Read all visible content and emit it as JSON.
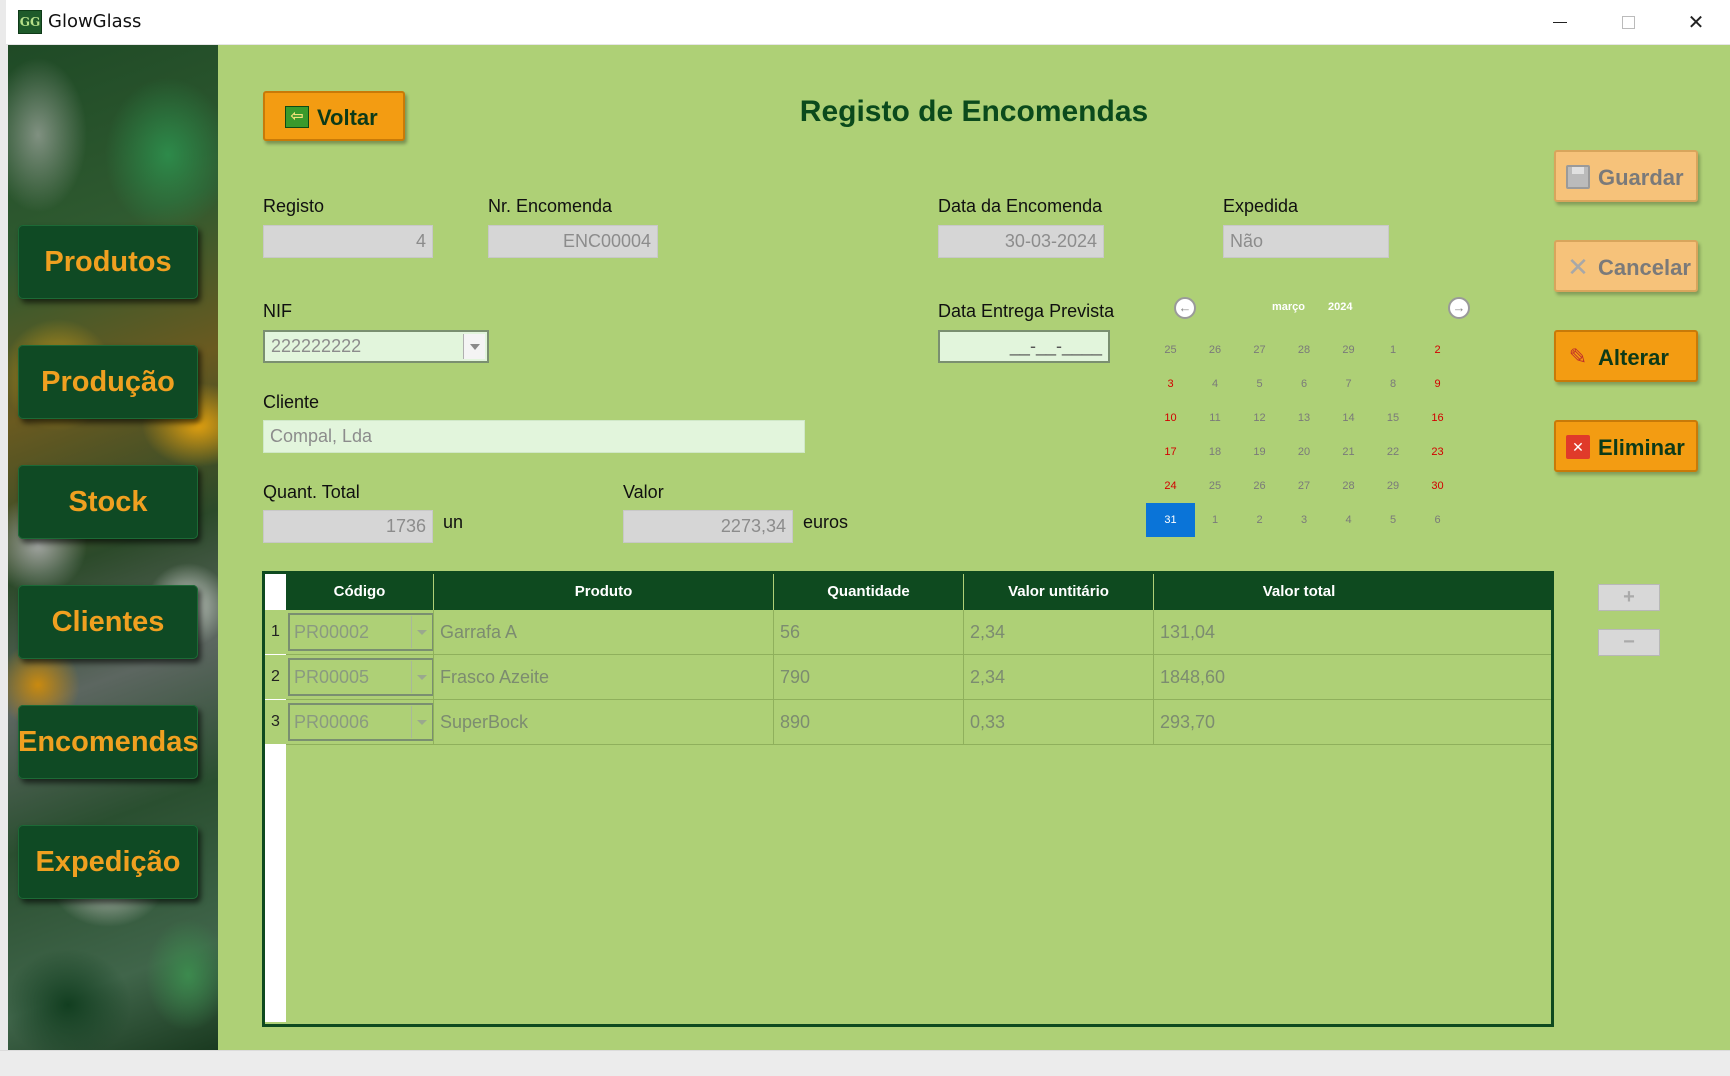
{
  "window": {
    "title": "GlowGlass",
    "icon_text": "GG",
    "minimize_icon": "minimize-icon",
    "maximize_icon": "maximize-icon",
    "close_icon": "close-icon",
    "close_glyph": "✕"
  },
  "sidebar": {
    "items": [
      {
        "label": "Produtos"
      },
      {
        "label": "Produção"
      },
      {
        "label": "Stock"
      },
      {
        "label": "Clientes"
      },
      {
        "label": "Encomendas"
      },
      {
        "label": "Expedição"
      }
    ]
  },
  "header": {
    "back_label": "Voltar",
    "back_glyph": "⇦",
    "title": "Registo de Encomendas"
  },
  "form": {
    "registo": {
      "label": "Registo",
      "value": "4"
    },
    "nr_encomenda": {
      "label": "Nr. Encomenda",
      "value": "ENC00004"
    },
    "data_encomenda": {
      "label": "Data da Encomenda",
      "value": "30-03-2024"
    },
    "expedida": {
      "label": "Expedida",
      "value": "Não"
    },
    "nif": {
      "label": "NIF",
      "value": "222222222"
    },
    "data_entrega": {
      "label": "Data Entrega Prevista",
      "value": "__-__-____"
    },
    "cliente": {
      "label": "Cliente",
      "value": "Compal, Lda"
    },
    "quant_total": {
      "label": "Quant. Total",
      "value": "1736",
      "unit": "un"
    },
    "valor": {
      "label": "Valor",
      "value": "2273,34",
      "unit": "euros"
    }
  },
  "calendar": {
    "month": "março",
    "year": "2024",
    "prev_glyph": "←",
    "next_glyph": "→",
    "selected": "31",
    "weeks": [
      [
        "25",
        "26",
        "27",
        "28",
        "29",
        "1",
        "2"
      ],
      [
        "3",
        "4",
        "5",
        "6",
        "7",
        "8",
        "9"
      ],
      [
        "10",
        "11",
        "12",
        "13",
        "14",
        "15",
        "16"
      ],
      [
        "17",
        "18",
        "19",
        "20",
        "21",
        "22",
        "23"
      ],
      [
        "24",
        "25",
        "26",
        "27",
        "28",
        "29",
        "30"
      ],
      [
        "31",
        "1",
        "2",
        "3",
        "4",
        "5",
        "6"
      ]
    ]
  },
  "actions": {
    "guardar": {
      "label": "Guardar",
      "glyph": ""
    },
    "cancelar": {
      "label": "Cancelar",
      "glyph": "✕"
    },
    "alterar": {
      "label": "Alterar",
      "glyph": "✎"
    },
    "eliminar": {
      "label": "Eliminar",
      "glyph": "✕"
    }
  },
  "table": {
    "columns": [
      "Código",
      "Produto",
      "Quantidade",
      "Valor untitário",
      "Valor total"
    ],
    "rows": [
      {
        "num": "1",
        "codigo": "PR00002",
        "produto": "Garrafa A",
        "quantidade": "56",
        "valor_unit": "2,34",
        "valor_total": "131,04"
      },
      {
        "num": "2",
        "codigo": "PR00005",
        "produto": "Frasco Azeite",
        "quantidade": "790",
        "valor_unit": "2,34",
        "valor_total": "1848,60"
      },
      {
        "num": "3",
        "codigo": "PR00006",
        "produto": "SuperBock",
        "quantidade": "890",
        "valor_unit": "0,33",
        "valor_total": "293,70"
      }
    ],
    "add_glyph": "+",
    "remove_glyph": "−"
  },
  "colors": {
    "main_bg": "#aed076",
    "dark_green": "#0e4a1f",
    "orange": "#f39c12",
    "title_green": "#0b4a1c",
    "selected_blue": "#0a74d8",
    "weekend_red": "#d20000"
  }
}
